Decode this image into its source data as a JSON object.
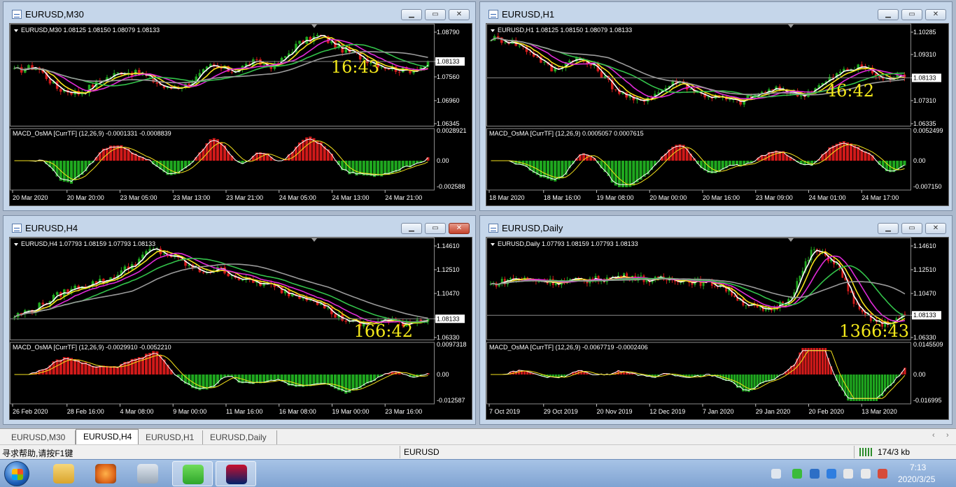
{
  "windows": [
    {
      "id": "m30",
      "title": "EURUSD,M30",
      "symbol_line": "EURUSD,M30  1.08125 1.08150 1.08079 1.08133",
      "price_axis": [
        "1.08790",
        "1.08133",
        "1.07560",
        "1.06960",
        "1.06345"
      ],
      "current_price": "1.08133",
      "macd_label": "MACD_OsMA [CurrTF] (12,26,9) -0.0001331 -0.0008839",
      "macd_axis": [
        "0.0028921",
        "0.00",
        "-0.002588"
      ],
      "time_axis": [
        "20 Mar 2020",
        "20 Mar 20:00",
        "23 Mar 05:00",
        "23 Mar 13:00",
        "23 Mar 21:00",
        "24 Mar 05:00",
        "24 Mar 13:00",
        "24 Mar 21:00"
      ],
      "countdown": "16:43"
    },
    {
      "id": "h1",
      "title": "EURUSD,H1",
      "symbol_line": "EURUSD,H1  1.08125 1.08150 1.08079 1.08133",
      "price_axis": [
        "1.10285",
        "1.09310",
        "1.08133",
        "1.07310",
        "1.06335"
      ],
      "current_price": "1.08133",
      "macd_label": "MACD_OsMA [CurrTF] (12,26,9) 0.0005057 0.0007615",
      "macd_axis": [
        "0.0052499",
        "0.00",
        "-0.007150"
      ],
      "time_axis": [
        "18 Mar 2020",
        "18 Mar 16:00",
        "19 Mar 08:00",
        "20 Mar 00:00",
        "20 Mar 16:00",
        "23 Mar 09:00",
        "24 Mar 01:00",
        "24 Mar 17:00"
      ],
      "countdown": "46:42"
    },
    {
      "id": "h4",
      "title": "EURUSD,H4",
      "symbol_line": "EURUSD,H4  1.07793 1.08159 1.07793 1.08133",
      "price_axis": [
        "1.14610",
        "1.12510",
        "1.10470",
        "1.08133",
        "1.06330"
      ],
      "current_price": "1.08133",
      "macd_label": "MACD_OsMA [CurrTF] (12,26,9) -0.0029910 -0.0052210",
      "macd_axis": [
        "0.0097318",
        "0.00",
        "-0.012587"
      ],
      "time_axis": [
        "26 Feb 2020",
        "28 Feb 16:00",
        "4 Mar 08:00",
        "9 Mar 00:00",
        "11 Mar 16:00",
        "16 Mar 08:00",
        "19 Mar 00:00",
        "23 Mar 16:00"
      ],
      "countdown": "166:42"
    },
    {
      "id": "daily",
      "title": "EURUSD,Daily",
      "symbol_line": "EURUSD,Daily  1.07793 1.08159 1.07793 1.08133",
      "price_axis": [
        "1.14610",
        "1.12510",
        "1.10470",
        "1.08133",
        "1.06330"
      ],
      "current_price": "1.08133",
      "macd_label": "MACD_OsMA [CurrTF] (12,26,9) -0.0067719 -0.0002406",
      "macd_axis": [
        "0.0145509",
        "0.00",
        "-0.016995"
      ],
      "time_axis": [
        "7 Oct 2019",
        "29 Oct 2019",
        "20 Nov 2019",
        "12 Dec 2019",
        "7 Jan 2020",
        "29 Jan 2020",
        "20 Feb 2020",
        "13 Mar 2020"
      ],
      "countdown": "1366:43"
    }
  ],
  "tabs": [
    "EURUSD,M30",
    "EURUSD,H4",
    "EURUSD,H1",
    "EURUSD,Daily"
  ],
  "active_tab": "EURUSD,H4",
  "status": {
    "help": "寻求帮助,请按F1键",
    "symbol": "EURUSD",
    "traffic": "174/3 kb"
  },
  "clock": {
    "time": "7:13",
    "date": "2020/3/25"
  },
  "colors": {
    "bull": "#1fa81f",
    "bear": "#d11a1a",
    "ma_white": "#ffffff",
    "ma_yellow": "#f5e21b",
    "ma_magenta": "#e02ad8",
    "ma_green": "#33c24a",
    "ma_gray": "#9a9a9a",
    "countdown": "#f3e81a"
  }
}
